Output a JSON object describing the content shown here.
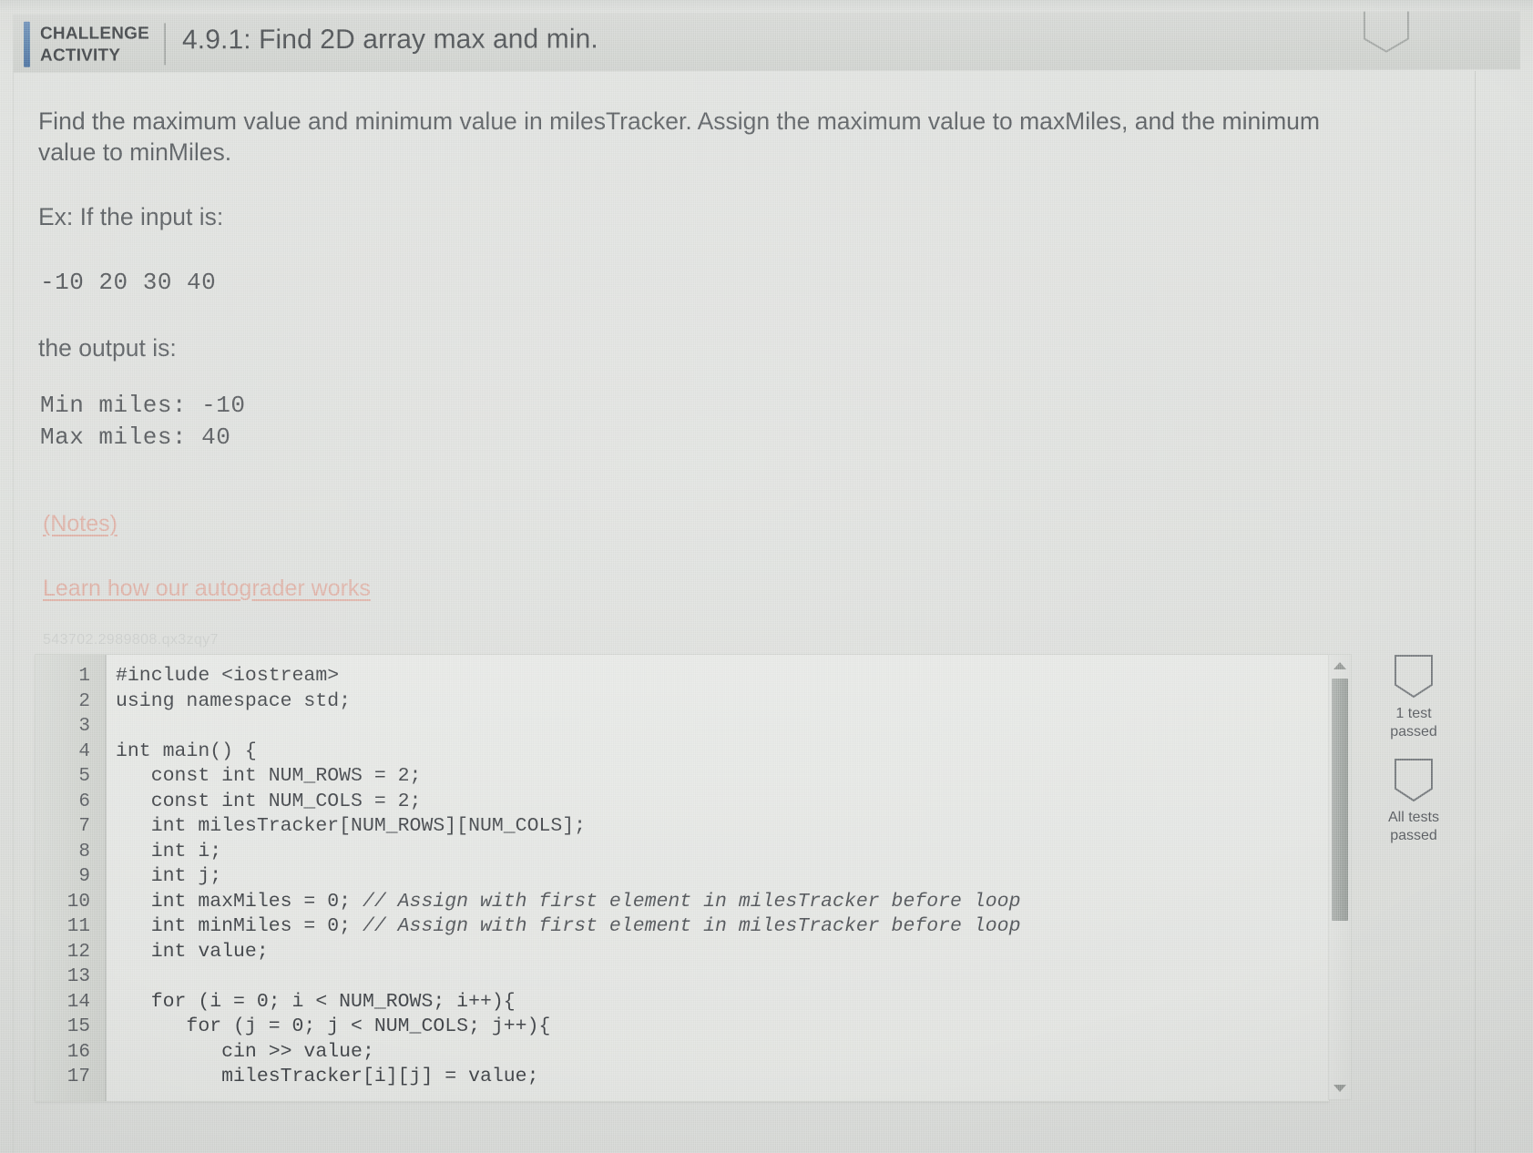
{
  "header": {
    "label": "CHALLENGE ACTIVITY",
    "label_line1": "CHALLENGE",
    "label_line2": "ACTIVITY",
    "title": "4.9.1: Find 2D array max and min.",
    "accent_color": "#5a7ba8",
    "badge_icon": "bookmark-ribbon-icon"
  },
  "prompt": {
    "text": "Find the maximum value and minimum value in milesTracker. Assign the maximum value to maxMiles, and the minimum value to minMiles.",
    "example_intro": "Ex: If the input is:",
    "example_input": "-10 20 30 40",
    "output_intro": "the output is:",
    "output_line1": "Min miles: -10",
    "output_line2": "Max miles: 40"
  },
  "links": {
    "notes": "(Notes)",
    "autograder": "Learn how our autograder works",
    "color": "#d9a79b"
  },
  "activity_id": "543702.2989808.qx3zqy7",
  "editor": {
    "language": "cpp",
    "lines": [
      {
        "n": "1",
        "code": "#include <iostream>"
      },
      {
        "n": "2",
        "code": "using namespace std;"
      },
      {
        "n": "3",
        "code": ""
      },
      {
        "n": "4",
        "code": "int main() {"
      },
      {
        "n": "5",
        "code": "   const int NUM_ROWS = 2;"
      },
      {
        "n": "6",
        "code": "   const int NUM_COLS = 2;"
      },
      {
        "n": "7",
        "code": "   int milesTracker[NUM_ROWS][NUM_COLS];"
      },
      {
        "n": "8",
        "code": "   int i;"
      },
      {
        "n": "9",
        "code": "   int j;"
      },
      {
        "n": "10",
        "code": "   int maxMiles = 0; ",
        "comment": "// Assign with first element in milesTracker before loop"
      },
      {
        "n": "11",
        "code": "   int minMiles = 0; ",
        "comment": "// Assign with first element in milesTracker before loop"
      },
      {
        "n": "12",
        "code": "   int value;"
      },
      {
        "n": "13",
        "code": ""
      },
      {
        "n": "14",
        "code": "   for (i = 0; i < NUM_ROWS; i++){"
      },
      {
        "n": "15",
        "code": "      for (j = 0; j < NUM_COLS; j++){"
      },
      {
        "n": "16",
        "code": "         cin >> value;"
      },
      {
        "n": "17",
        "code": "         milesTracker[i][j] = value;"
      }
    ],
    "scrollbar": {
      "up_arrow": "caret-up-icon",
      "down_arrow": "caret-down-icon"
    }
  },
  "tests": [
    {
      "icon": "trophy-badge-icon",
      "label_line1": "1 test",
      "label_line2": "passed"
    },
    {
      "icon": "trophy-badge-icon",
      "label_line1": "All tests",
      "label_line2": "passed"
    }
  ]
}
